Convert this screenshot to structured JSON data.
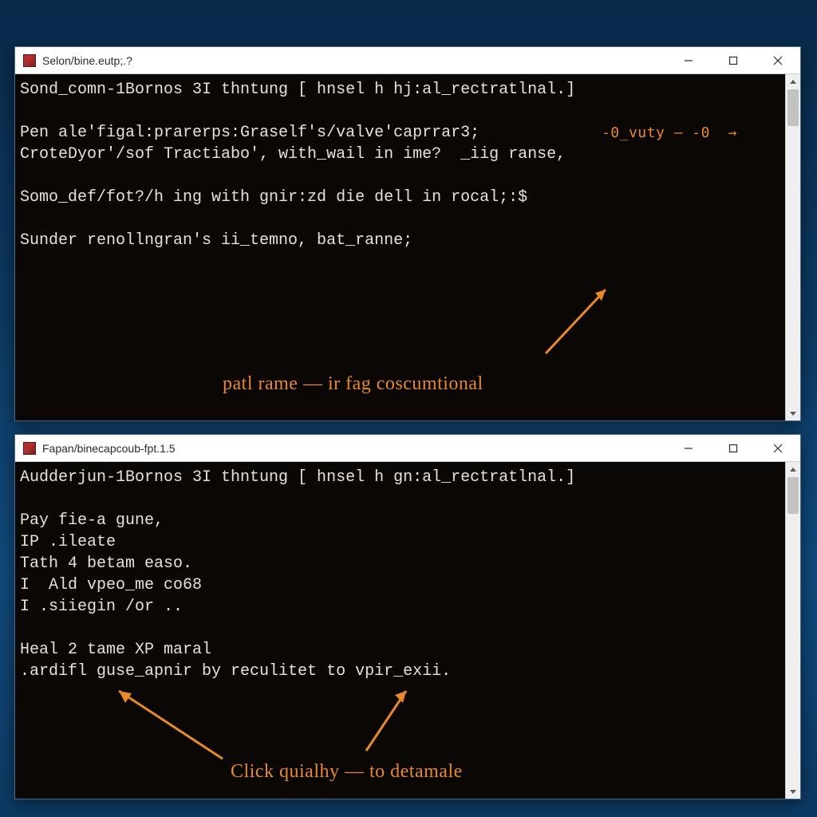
{
  "windows": [
    {
      "title": "Selon/bine.eutp;.?",
      "lines": [
        "Sond_comn-1Bornos 3I thntung [ hnsel h hj:al_rectratlnal.]",
        "",
        "Pen ale'figal:prarerps:Graself's/valve'caprrar3;",
        "CroteDyor'/sof Tractiabo', with_wail in ime?  _iig ranse,",
        "",
        "Somo_def/fot?/h ing with gnir:zd die dell in rocal;:$",
        "",
        "Sunder renollngran's ii_temno, bat_ranne;"
      ],
      "annotation_right": "-0_vuty — -0  →",
      "annotation_bottom": "patl rame — ir fag coscumtional"
    },
    {
      "title": "Fapan/binecapcoub-fpt.1.5",
      "lines": [
        "Audderjun-1Bornos 3I thntung [ hnsel h gn:al_rectratlnal.]",
        "",
        "Pay fie-a gune,",
        "IP .ileate",
        "Tath 4 betam easo.",
        "I  Ald vpeo_me co68",
        "I .siiegin /or ..",
        "",
        "Heal 2 tame XP maral",
        ".ardifl guse_apnir by reculitet to vpir_exii."
      ],
      "annotation_bottom": "Click quialhy — to detamale"
    }
  ],
  "colors": {
    "annotation": "#e88a2a",
    "console_bg": "#0b0704",
    "console_fg": "#e8e2d6"
  }
}
